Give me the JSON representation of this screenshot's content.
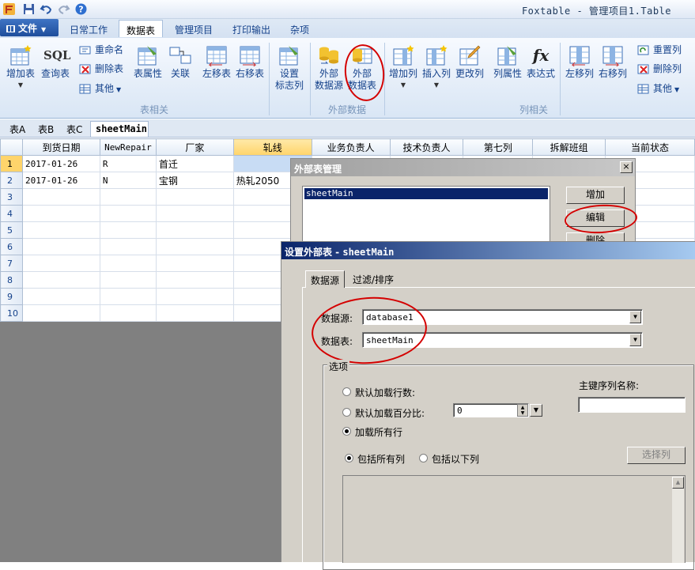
{
  "app": {
    "title": "Foxtable - 管理项目1.Table"
  },
  "ribbon_tabs": {
    "file": "文件",
    "daily": "日常工作",
    "datatable": "数据表",
    "manage": "管理项目",
    "print": "打印输出",
    "misc": "杂项"
  },
  "ribbon": {
    "add_table": "增加表",
    "query_table": "查询表",
    "sql_icon_text": "SQL",
    "rename": "重命名",
    "delete_table": "删除表",
    "other": "其他",
    "table_props": "表属性",
    "relation": "关联",
    "move_table_left": "左移表",
    "move_table_right": "右移表",
    "set_flag_col_1": "设置",
    "set_flag_col_2": "标志列",
    "ext_source_1": "外部",
    "ext_source_2": "数据源",
    "ext_table_1": "外部",
    "ext_table_2": "数据表",
    "add_col": "增加列",
    "insert_col": "插入列",
    "change_col": "更改列",
    "col_props": "列属性",
    "expression": "表达式",
    "fx_icon_text": "fx",
    "move_col_left": "左移列",
    "move_col_right": "右移列",
    "reset_col": "重置列",
    "delete_col": "删除列",
    "other2": "其他",
    "group_table": "表相关",
    "group_external": "外部数据",
    "group_column": "列相关"
  },
  "sheet_tabs": [
    "表A",
    "表B",
    "表C",
    "sheetMain"
  ],
  "grid": {
    "columns": [
      "到货日期",
      "NewRepair",
      "厂家",
      "轧线",
      "业务负责人",
      "技术负责人",
      "第七列",
      "拆解班组",
      "当前状态"
    ],
    "row_numbers": [
      "1",
      "2",
      "3",
      "4",
      "5",
      "6",
      "7",
      "8",
      "9",
      "10"
    ],
    "rows": [
      [
        "2017-01-26",
        "R",
        "首迁",
        "",
        "",
        "",
        "",
        "",
        ""
      ],
      [
        "2017-01-26",
        "N",
        "宝钢",
        "热轧2050",
        "",
        "",
        "",
        "",
        ""
      ]
    ]
  },
  "dialog_external_tables": {
    "title": "外部表管理",
    "close": "×",
    "items": [
      "sheetMain"
    ],
    "add_button": "增加",
    "edit_button": "编辑",
    "delete_button": "删除"
  },
  "dialog_setup": {
    "title_prefix": "设置外部表 - ",
    "title_table": "sheetMain",
    "tabs": [
      "数据源",
      "过滤/排序"
    ],
    "source_label": "数据源:",
    "source_value": "database1",
    "table_label": "数据表:",
    "table_value": "sheetMain",
    "options_group": "选项",
    "opt_default_rows": "默认加载行数:",
    "opt_default_percent": "默认加载百分比:",
    "opt_load_all": "加载所有行",
    "percent_value": "0",
    "pk_label": "主键序列名称:",
    "pk_value": "",
    "include_all_cols": "包括所有列",
    "include_following_cols": "包括以下列",
    "select_cols_button": "选择列"
  }
}
